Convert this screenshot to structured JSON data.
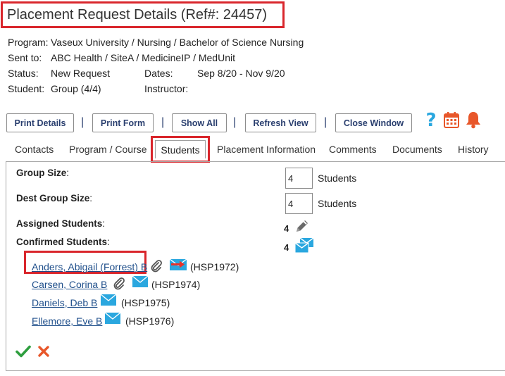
{
  "header": {
    "title": "Placement Request Details (Ref#: 24457)"
  },
  "details": {
    "program_label": "Program:",
    "program_value": "Vaseux University / Nursing / Bachelor of Science Nursing",
    "sent_label": "Sent to:",
    "sent_value": "ABC Health / SiteA / MedicineIP / MedUnit",
    "status_label": "Status:",
    "status_value": "New Request",
    "dates_label": "Dates:",
    "dates_value": "Sep 8/20 - Nov 9/20",
    "student_label": "Student:",
    "student_value": "Group (4/4)",
    "instructor_label": "Instructor:",
    "instructor_value": ""
  },
  "toolbar": {
    "print_details": "Print Details",
    "print_form": "Print Form",
    "show_all": "Show All",
    "refresh_view": "Refresh View",
    "close_window": "Close Window",
    "separator": "|"
  },
  "tabs": [
    {
      "label": "Contacts"
    },
    {
      "label": "Program / Course"
    },
    {
      "label": "Students",
      "active": true
    },
    {
      "label": "Placement Information"
    },
    {
      "label": "Comments"
    },
    {
      "label": "Documents"
    },
    {
      "label": "History"
    }
  ],
  "students_tab": {
    "group_size_label": "Group Size",
    "group_size_value": "4",
    "dest_group_size_label": "Dest Group Size",
    "dest_group_size_value": "4",
    "unit_label": "Students",
    "assigned_label": "Assigned Students",
    "assigned_count": "4",
    "confirmed_label": "Confirmed Students",
    "confirmed_count": "4",
    "colon": ":",
    "students": [
      {
        "name": "Anders, Abigail (Forrest) B",
        "code": "(HSP1972)"
      },
      {
        "name": "Carsen, Corina B",
        "code": "(HSP1974)"
      },
      {
        "name": "Daniels, Deb B",
        "code": "(HSP1975)"
      },
      {
        "name": "Ellemore, Eve B",
        "code": "(HSP1976)"
      }
    ]
  },
  "colors": {
    "highlight": "#d9262c",
    "link": "#1f4f8b",
    "icon_blue": "#2aa7df",
    "icon_orange": "#e8572a",
    "confirm_green": "#2e9e3e",
    "cancel_red": "#e8572a"
  }
}
